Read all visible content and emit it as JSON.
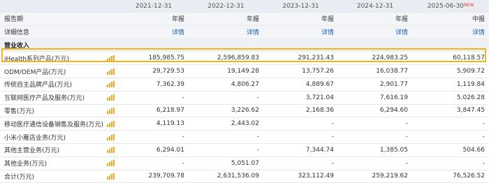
{
  "header": {
    "col0": "",
    "periods": [
      "2021-12-31",
      "2022-12-31",
      "2023-12-31",
      "2024-12-31",
      "2025-06-30"
    ],
    "new_badge": "NEW"
  },
  "report_period": {
    "label": "报告期",
    "values": [
      "年报",
      "年报",
      "年报",
      "年报",
      "中报"
    ]
  },
  "details": {
    "label": "详细信息",
    "values": [
      "详情",
      "详情",
      "详情",
      "详情",
      "详情"
    ]
  },
  "section": {
    "label": "营业收入"
  },
  "rows": [
    {
      "label": "iHealth系列产品(万元)",
      "values": [
        "185,985.75",
        "2,596,859.83",
        "291,231.43",
        "224,983.25",
        "60,118.57"
      ]
    },
    {
      "label": "ODM/OEM产品(万元)",
      "values": [
        "29,729.53",
        "19,149.28",
        "13,757.26",
        "16,038.77",
        "5,909.72"
      ]
    },
    {
      "label": "传统自主品牌产品(万元)",
      "values": [
        "7,362.39",
        "4,806.27",
        "4,889.67",
        "2,901.77",
        "1,119.84"
      ]
    },
    {
      "label": "互联网医疗产品及服务(万元)",
      "values": [
        "-",
        "-",
        "3,721.04",
        "7,616.19",
        "5,026.28"
      ]
    },
    {
      "label": "零售(万元)",
      "values": [
        "6,218.97",
        "3,226.62",
        "2,168.36",
        "6,294.60",
        "3,847.45"
      ]
    },
    {
      "label": "移动医疗通信设备销售及服务(万元)",
      "values": [
        "4,119.13",
        "2,443.02",
        "-",
        "-",
        "-"
      ]
    },
    {
      "label": "小米小雁店业务(万元)",
      "values": [
        "-",
        "-",
        "-",
        "-",
        "-"
      ]
    },
    {
      "label": "其他主营业务(万元)",
      "values": [
        "6,294.01",
        "-",
        "7,344.74",
        "1,385.05",
        "504.66"
      ]
    },
    {
      "label": "其他业务(万元)",
      "values": [
        "-",
        "5,051.07",
        "-",
        "-",
        "-"
      ]
    },
    {
      "label": "合计(万元)",
      "values": [
        "239,709.78",
        "2,631,536.09",
        "323,112.49",
        "259,219.62",
        "76,526.52"
      ]
    }
  ],
  "colors": {
    "highlight": "#f5b41a",
    "link": "#1a5fb4",
    "chart_icon": "#f5a623"
  }
}
